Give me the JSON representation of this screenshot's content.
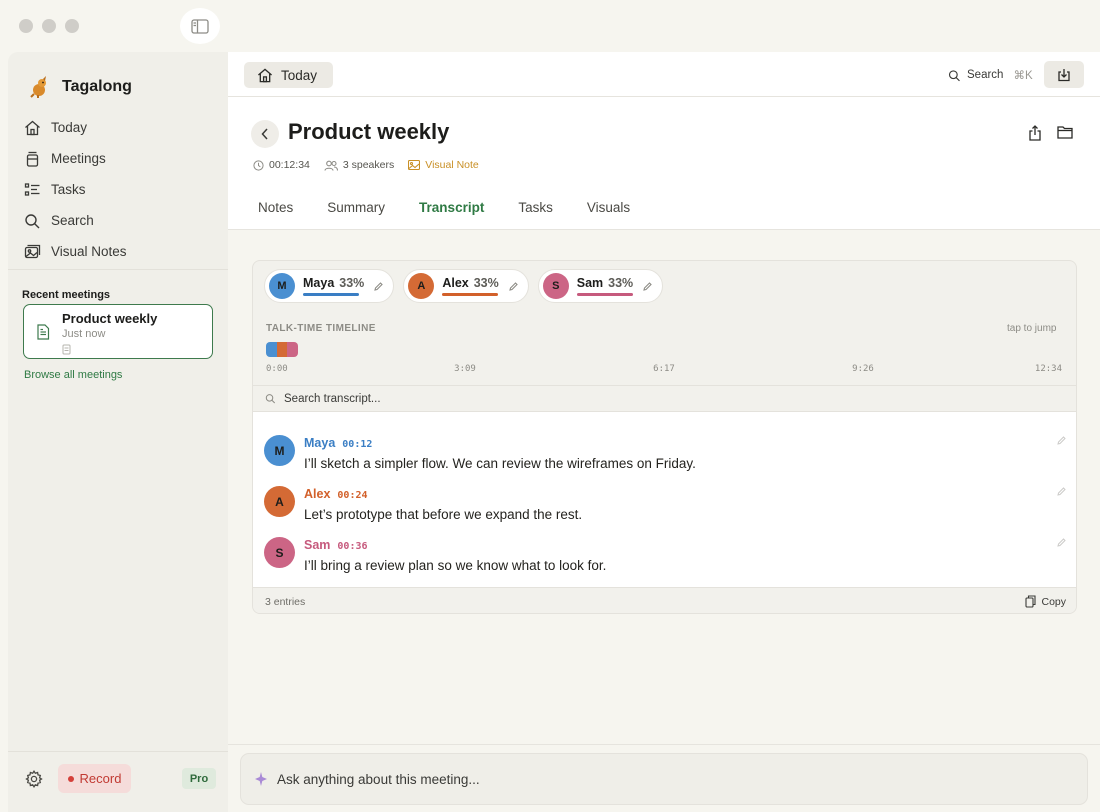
{
  "app": {
    "name": "Tagalong",
    "colors": {
      "accent": "#2f7a44",
      "record": "#c13a33",
      "visual_note": "#c99026"
    }
  },
  "sidebar": {
    "items": [
      {
        "label": "Today",
        "icon": "home-icon"
      },
      {
        "label": "Meetings",
        "icon": "meetings-icon"
      },
      {
        "label": "Tasks",
        "icon": "tasks-icon"
      },
      {
        "label": "Search",
        "icon": "search-icon"
      },
      {
        "label": "Visual Notes",
        "icon": "visual-notes-icon"
      }
    ],
    "recent_title": "Recent meetings",
    "recent": [
      {
        "title": "Product weekly",
        "subtitle": "Just now"
      }
    ],
    "browse_link": "Browse all meetings",
    "record_label": "Record",
    "pro_label": "Pro"
  },
  "topbar": {
    "today_label": "Today",
    "search_label": "Search",
    "search_shortcut": "⌘K"
  },
  "meeting": {
    "title": "Product weekly",
    "duration": "00:12:34",
    "speakers_label": "3 speakers",
    "visual_note_label": "Visual Note"
  },
  "tabs": [
    {
      "label": "Notes",
      "active": false
    },
    {
      "label": "Summary",
      "active": false
    },
    {
      "label": "Transcript",
      "active": true
    },
    {
      "label": "Tasks",
      "active": false
    },
    {
      "label": "Visuals",
      "active": false
    }
  ],
  "transcript": {
    "speakers": [
      {
        "initial": "M",
        "name": "Maya",
        "percent": "33%",
        "share": 0.33,
        "color": "#4a8fd1",
        "bar_color": "#3a7ec4"
      },
      {
        "initial": "A",
        "name": "Alex",
        "percent": "33%",
        "share": 0.33,
        "color": "#d46a35",
        "bar_color": "#d2602a"
      },
      {
        "initial": "S",
        "name": "Sam",
        "percent": "33%",
        "share": 0.33,
        "color": "#cc6585",
        "bar_color": "#c65a7d"
      }
    ],
    "timeline_label": "TALK-TIME TIMELINE",
    "timeline_hint": "tap to jump",
    "timeline_ticks": [
      "0:00",
      "3:09",
      "6:17",
      "9:26",
      "12:34"
    ],
    "search_placeholder": "Search transcript...",
    "entries": [
      {
        "speaker": "Maya",
        "initial": "M",
        "time": "00:12",
        "text": "I’ll sketch a simpler flow. We can review the wireframes on Friday.",
        "color": "#4a8fd1",
        "name_color": "#3a7ec4"
      },
      {
        "speaker": "Alex",
        "initial": "A",
        "time": "00:24",
        "text": "Let’s prototype that before we expand the rest.",
        "color": "#d46a35",
        "name_color": "#d2602a"
      },
      {
        "speaker": "Sam",
        "initial": "S",
        "time": "00:36",
        "text": "I’ll bring a review plan so we know what to look for.",
        "color": "#cc6585",
        "name_color": "#c65a7d"
      }
    ],
    "entry_count": "3 entries",
    "copy_label": "Copy"
  },
  "ask": {
    "placeholder": "Ask anything about this meeting..."
  }
}
